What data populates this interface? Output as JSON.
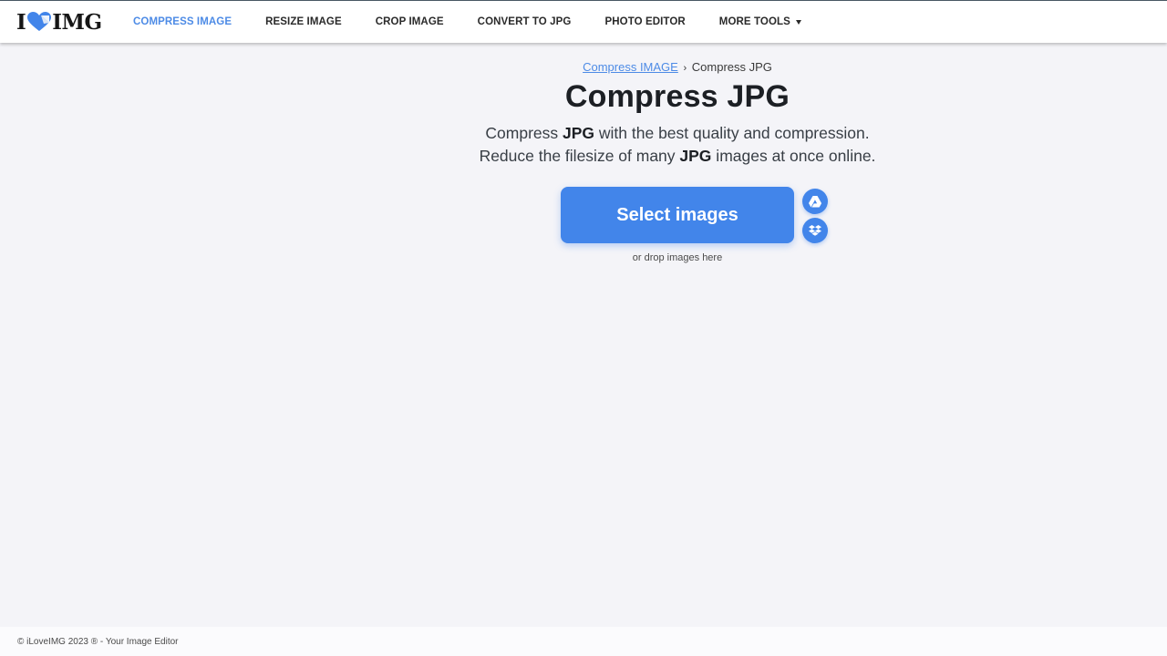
{
  "header": {
    "logo": {
      "text_left": "I",
      "text_right": "IMG",
      "icon": "heart-icon"
    },
    "nav": [
      {
        "label": "COMPRESS IMAGE",
        "active": true
      },
      {
        "label": "RESIZE IMAGE",
        "active": false
      },
      {
        "label": "CROP IMAGE",
        "active": false
      },
      {
        "label": "CONVERT TO JPG",
        "active": false
      },
      {
        "label": "PHOTO EDITOR",
        "active": false
      },
      {
        "label": "MORE TOOLS",
        "active": false,
        "icon": "caret-down-icon"
      }
    ]
  },
  "main": {
    "breadcrumb": {
      "parent": "Compress IMAGE",
      "separator": "›",
      "current": "Compress JPG"
    },
    "title": "Compress JPG",
    "subtitle": {
      "line1": {
        "pre": "Compress ",
        "bold": "JPG",
        "post": " with the best quality and compression."
      },
      "line2": {
        "pre": "Reduce the filesize of many ",
        "bold": "JPG",
        "post": " images at once online."
      }
    },
    "upload_button": "Select images",
    "cloud_buttons": [
      {
        "name": "google-drive",
        "icon": "google-drive-icon"
      },
      {
        "name": "dropbox",
        "icon": "dropbox-icon"
      }
    ],
    "drop_hint": "or drop images here"
  },
  "footer": {
    "text": "© iLoveIMG 2023 ® - Your Image Editor"
  },
  "colors": {
    "accent": "#4285ea",
    "nav_active": "#4d8be6",
    "background": "#f4f4f8",
    "header_bg": "#ffffff",
    "text_dark": "#1c1f24"
  }
}
